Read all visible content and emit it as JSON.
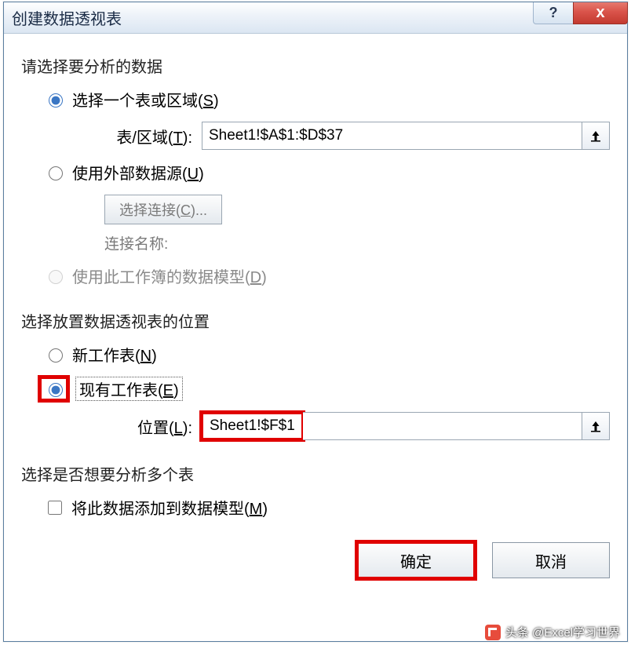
{
  "titlebar": {
    "title": "创建数据透视表",
    "help_label": "?",
    "close_label": "x"
  },
  "section1": {
    "title": "请选择要分析的数据",
    "opt1": "选择一个表或区域(",
    "opt1_key": "S",
    "opt1_suffix": ")",
    "range_label_pre": "表/区域(",
    "range_label_key": "T",
    "range_label_suf": "):",
    "range_value": "Sheet1!$A$1:$D$37",
    "opt2": "使用外部数据源(",
    "opt2_key": "U",
    "opt2_suffix": ")",
    "choose_conn": "选择连接(",
    "choose_conn_key": "C",
    "choose_conn_suf": ")...",
    "conn_name_label": "连接名称:",
    "opt3": "使用此工作簿的数据模型(",
    "opt3_key": "D",
    "opt3_suffix": ")"
  },
  "section2": {
    "title": "选择放置数据透视表的位置",
    "opt1": "新工作表(",
    "opt1_key": "N",
    "opt1_suffix": ")",
    "opt2": "现有工作表(",
    "opt2_key": "E",
    "opt2_suffix": ")",
    "loc_label_pre": "位置(",
    "loc_label_key": "L",
    "loc_label_suf": "):",
    "loc_value": "Sheet1!$F$1"
  },
  "section3": {
    "title": "选择是否想要分析多个表",
    "chk": "将此数据添加到数据模型(",
    "chk_key": "M",
    "chk_suffix": ")"
  },
  "buttons": {
    "ok": "确定",
    "cancel": "取消"
  },
  "watermark": "头条 @Excel学习世界"
}
